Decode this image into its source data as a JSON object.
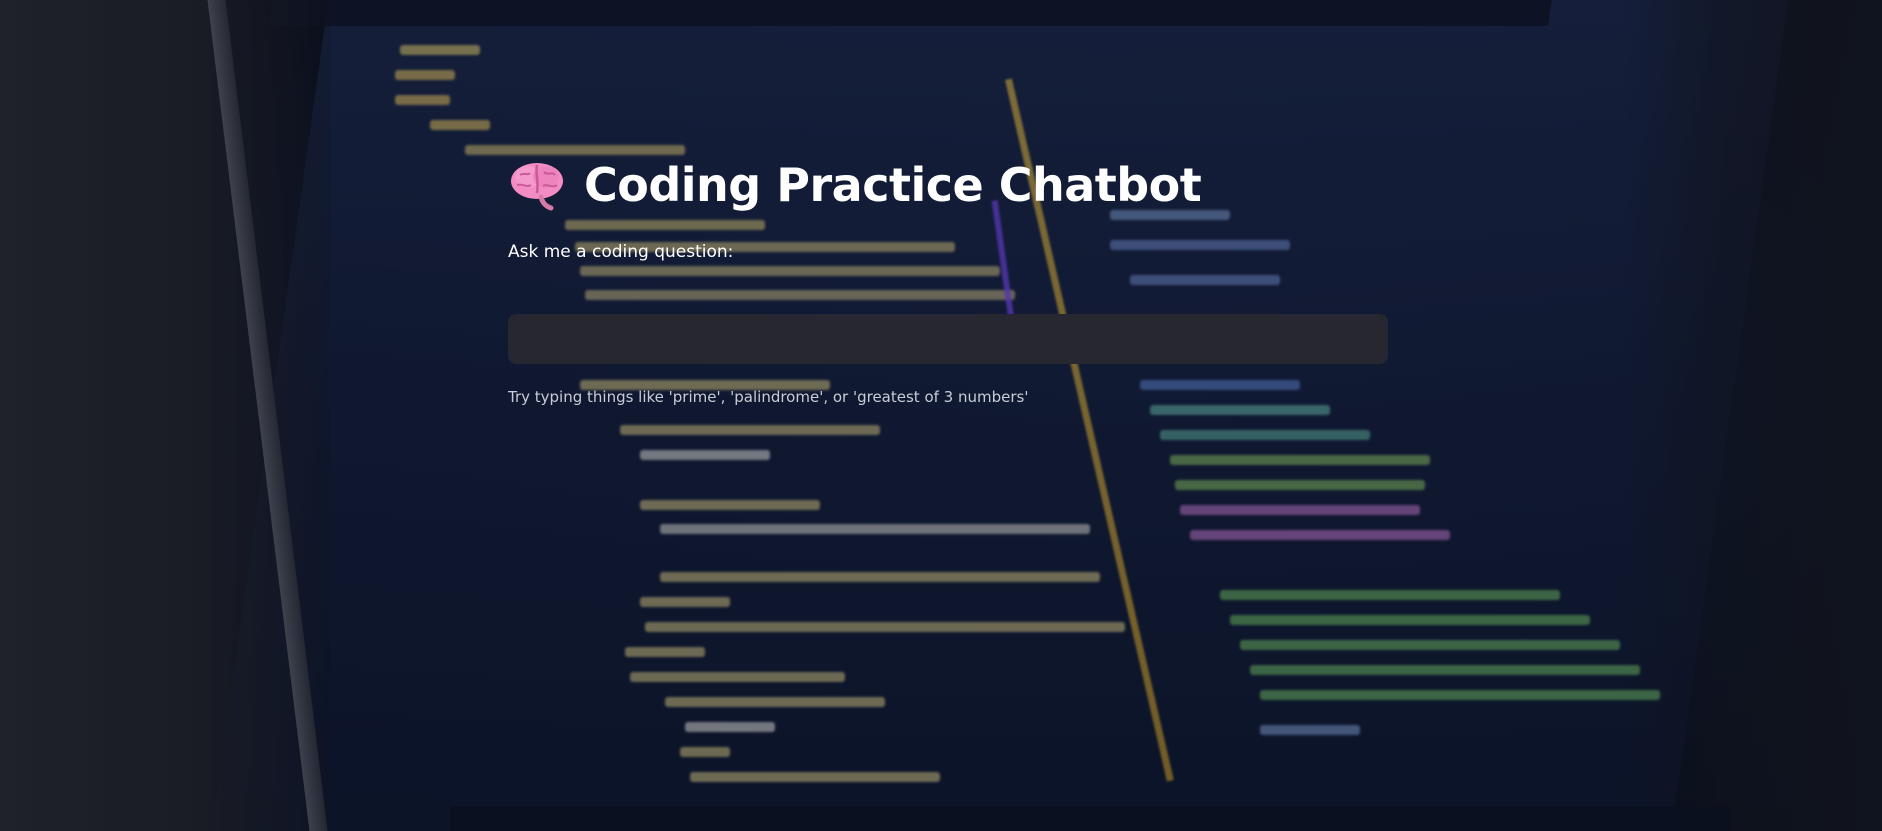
{
  "app": {
    "title": "Coding Practice Chatbot",
    "title_icon": "brain-icon",
    "prompt_label": "Ask me a coding question:",
    "input": {
      "value": "",
      "placeholder": ""
    },
    "hint": "Try typing things like 'prime', 'palindrome', or 'greatest of 3 numbers'"
  },
  "colors": {
    "input_background": "#262730",
    "text": "#ffffff",
    "hint_text": "#c9ccd4"
  }
}
